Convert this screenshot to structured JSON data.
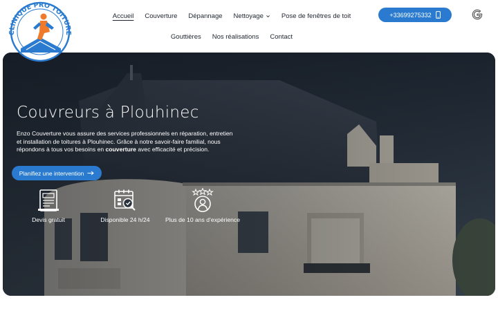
{
  "brand": {
    "logo_text": "CLINIQUE PRO TOITURE",
    "logo_colors": {
      "ring": "#2a7bcf",
      "accent": "#f07a2a"
    }
  },
  "nav": {
    "row1": [
      {
        "label": "Accueil",
        "active": true
      },
      {
        "label": "Couverture"
      },
      {
        "label": "Dépannage"
      },
      {
        "label": "Nettoyage",
        "dropdown": true
      },
      {
        "label": "Pose de fenêtres de toit"
      }
    ],
    "row2": [
      {
        "label": "Gouttières"
      },
      {
        "label": "Nos réalisations"
      },
      {
        "label": "Contact"
      }
    ]
  },
  "header_actions": {
    "phone_label": "+33699275332",
    "phone_icon": "mobile-phone-icon",
    "google_icon": "google-icon"
  },
  "hero": {
    "title": "Couvreurs à Plouhinec",
    "text_before": "Enzo Couverture vous assure des services professionnels en réparation, entretien et installation de toitures à Plouhinec. Grâce à notre savoir-faire familial, nous répondons à tous vos besoins en ",
    "text_bold": "couverture",
    "text_after": " avec efficacité et précision.",
    "cta_label": "Planifiez une intervention",
    "cta_icon": "arrow-right-icon"
  },
  "features": [
    {
      "label": "Devis gratuit",
      "icon": "quote-form-icon"
    },
    {
      "label": "Disponible 24 h/24",
      "icon": "calendar-clock-icon"
    },
    {
      "label": "Plus de 10 ans d’expérience",
      "icon": "expert-stars-icon"
    }
  ],
  "colors": {
    "accent": "#2a7bcf",
    "text_dark": "#1f2430",
    "hero_text": "#ffffff"
  }
}
